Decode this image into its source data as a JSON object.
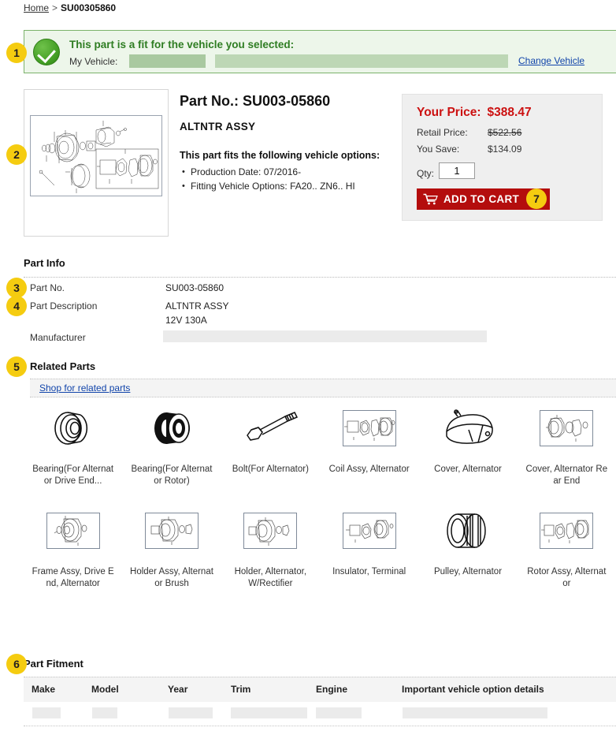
{
  "breadcrumb": {
    "home": "Home",
    "separator": ">",
    "current": "SU00305860"
  },
  "fitment_banner": {
    "badge": "1",
    "title": "This part is a fit for the vehicle you selected:",
    "my_vehicle_label": "My Vehicle:",
    "change_vehicle_link": "Change Vehicle",
    "bg_color": "#edf6ea",
    "border_color": "#7cb26a",
    "check_color": "#3f9a21"
  },
  "product": {
    "badge": "2",
    "part_no_label": "Part No.:",
    "part_no": "SU003-05860",
    "part_name": "ALTNTR ASSY",
    "fits_heading": "This part fits the following vehicle options:",
    "fits_options": [
      "Production Date: 07/2016-",
      "Fitting Vehicle Options: FA20.. ZN6.. HI"
    ],
    "image_alt": "exploded-alternator-diagram"
  },
  "price": {
    "your_price_label": "Your Price:",
    "your_price": "$388.47",
    "retail_label": "Retail Price:",
    "retail_price": "$522.56",
    "save_label": "You Save:",
    "save_amount": "$134.09",
    "qty_label": "Qty:",
    "qty_value": "1",
    "add_to_cart_label": "ADD TO CART",
    "add_to_cart_badge": "7",
    "accent_color": "#cc1111",
    "button_color": "#b40d0d"
  },
  "part_info": {
    "section_title": "Part Info",
    "rows": [
      {
        "badge": "3",
        "label": "Part No.",
        "value": "SU003-05860",
        "redacted": false
      },
      {
        "badge": "4",
        "label": "Part Description",
        "value": "ALTNTR ASSY",
        "value2": "12V 130A",
        "redacted": false
      },
      {
        "badge": "",
        "label": "Manufacturer",
        "value": "",
        "redacted": true
      }
    ]
  },
  "related_parts": {
    "badge": "5",
    "section_title": "Related Parts",
    "shop_link": "Shop for related parts",
    "items": [
      {
        "label": "Bearing(For Alternator Drive End...",
        "icon": "bearing-icon"
      },
      {
        "label": "Bearing(For Alternator Rotor)",
        "icon": "bearing-dark-icon"
      },
      {
        "label": "Bolt(For Alternator)",
        "icon": "bolt-icon"
      },
      {
        "label": "Coil Assy, Alternator",
        "icon": "diagram-icon"
      },
      {
        "label": "Cover, Alternator",
        "icon": "cover-icon"
      },
      {
        "label": "Cover, Alternator Rear End",
        "icon": "diagram-icon"
      },
      {
        "label": "Frame Assy, Drive End, Alternator",
        "icon": "diagram-icon"
      },
      {
        "label": "Holder Assy, Alternator Brush",
        "icon": "diagram-icon"
      },
      {
        "label": "Holder, Alternator, W/Rectifier",
        "icon": "diagram-icon"
      },
      {
        "label": "Insulator, Terminal",
        "icon": "diagram-icon"
      },
      {
        "label": "Pulley, Alternator",
        "icon": "pulley-icon"
      },
      {
        "label": "Rotor Assy, Alternator",
        "icon": "diagram-icon"
      }
    ]
  },
  "part_fitment": {
    "badge": "6",
    "section_title": "Part Fitment",
    "columns": [
      "Make",
      "Model",
      "Year",
      "Trim",
      "Engine",
      "Important vehicle option details"
    ],
    "rows": [
      {
        "make": "",
        "model": "",
        "year": "",
        "trim": "",
        "engine": "",
        "details": "",
        "redacted": true
      }
    ]
  }
}
